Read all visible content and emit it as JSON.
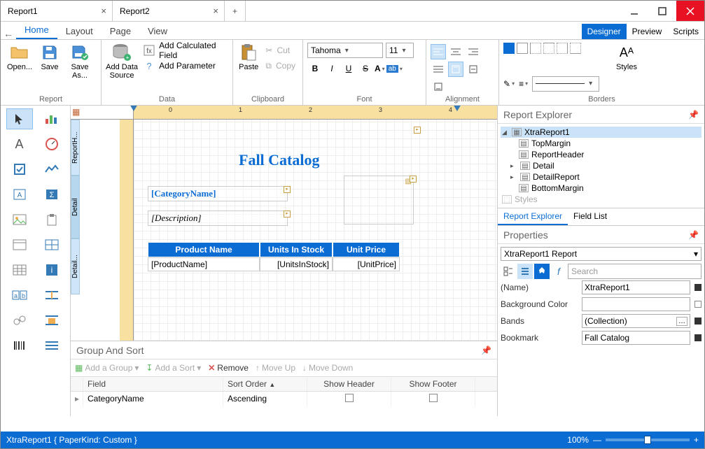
{
  "tabs": [
    {
      "title": "Report1",
      "active": true
    },
    {
      "title": "Report2",
      "active": false
    }
  ],
  "ribbon_tabs": [
    "Home",
    "Layout",
    "Page",
    "View"
  ],
  "ribbon_tabs_active": "Home",
  "right_tabs": [
    "Designer",
    "Preview",
    "Scripts"
  ],
  "right_tabs_active": "Designer",
  "ribbon": {
    "report": {
      "open": "Open...",
      "save": "Save",
      "saveAs": "Save As...",
      "group": "Report"
    },
    "data": {
      "addDataSource": "Add Data Source",
      "addCalc": "Add Calculated Field",
      "addParam": "Add Parameter",
      "group": "Data"
    },
    "clipboard": {
      "paste": "Paste",
      "cut": "Cut",
      "copy": "Copy",
      "group": "Clipboard"
    },
    "font": {
      "name": "Tahoma",
      "size": "11",
      "group": "Font"
    },
    "alignment": {
      "group": "Alignment"
    },
    "borders": {
      "styles": "Styles",
      "group": "Borders"
    }
  },
  "report_title": "Fall Catalog",
  "fields": {
    "category": "[CategoryName]",
    "description": "[Description]",
    "col_product": "Product Name",
    "col_stock": "Units In Stock",
    "col_price": "Unit Price",
    "val_product": "[ProductName]",
    "val_stock": "[UnitsInStock]",
    "val_price": "[UnitPrice]"
  },
  "band_labels": {
    "rh": "ReportH...",
    "detail": "Detail",
    "dr": "Detail..."
  },
  "groupsort": {
    "title": "Group And Sort",
    "addGroup": "Add a Group",
    "addSort": "Add a Sort",
    "remove": "Remove",
    "moveUp": "Move Up",
    "moveDown": "Move Down",
    "cols": {
      "field": "Field",
      "sort": "Sort Order",
      "showHeader": "Show Header",
      "showFooter": "Show Footer"
    },
    "rows": [
      {
        "field": "CategoryName",
        "sort": "Ascending",
        "showHeader": false,
        "showFooter": false
      }
    ]
  },
  "report_explorer": {
    "title": "Report Explorer",
    "tree": [
      {
        "label": "XtraReport1",
        "level": 0,
        "expanded": true,
        "selected": true
      },
      {
        "label": "TopMargin",
        "level": 1
      },
      {
        "label": "ReportHeader",
        "level": 1
      },
      {
        "label": "Detail",
        "level": 1,
        "expandable": true
      },
      {
        "label": "DetailReport",
        "level": 1,
        "expandable": true
      },
      {
        "label": "BottomMargin",
        "level": 1
      },
      {
        "label": "Styles",
        "level": 0,
        "faded": true
      }
    ],
    "tabs": [
      "Report Explorer",
      "Field List"
    ],
    "active_tab": "Report Explorer"
  },
  "properties": {
    "title": "Properties",
    "object": "XtraReport1  Report",
    "search_placeholder": "Search",
    "rows": [
      {
        "name": "(Name)",
        "value": "XtraReport1",
        "mark": "full"
      },
      {
        "name": "Background Color",
        "value": "",
        "hatch": true,
        "mark": "empty"
      },
      {
        "name": "Bands",
        "value": "(Collection)",
        "dots": true,
        "mark": "full"
      },
      {
        "name": "Bookmark",
        "value": "Fall Catalog",
        "mark": "full"
      }
    ]
  },
  "status": {
    "text": "XtraReport1 { PaperKind: Custom }",
    "zoom": "100%"
  }
}
